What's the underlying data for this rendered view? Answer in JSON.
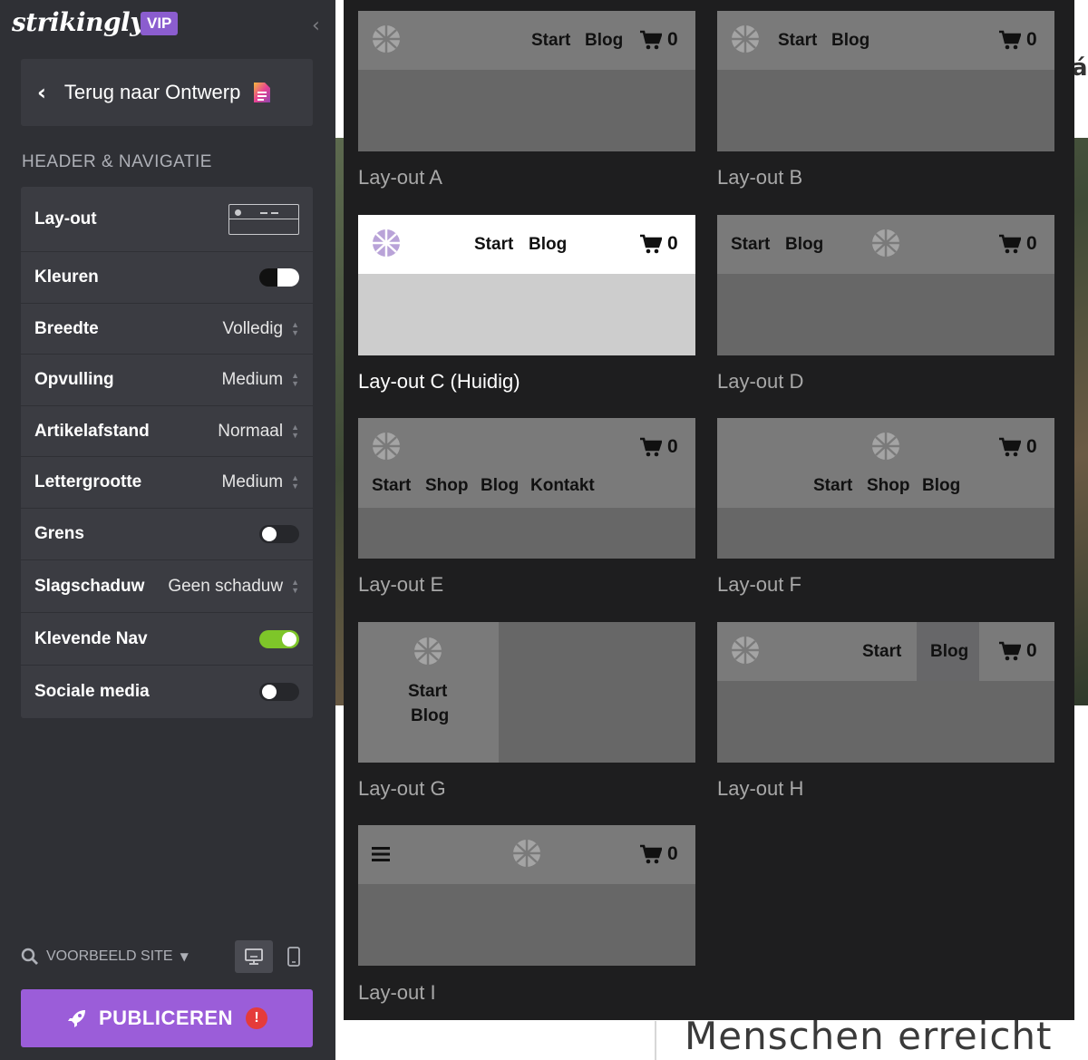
{
  "sidebar": {
    "brand": "strikingly",
    "badge": "VIP",
    "back_label": "Terug naar Ontwerp",
    "section_title": "HEADER & NAVIGATIE",
    "options": [
      {
        "name": "Lay-out",
        "kind": "thumb"
      },
      {
        "name": "Kleuren",
        "kind": "color-toggle"
      },
      {
        "name": "Breedte",
        "kind": "select",
        "value": "Volledig"
      },
      {
        "name": "Opvulling",
        "kind": "select",
        "value": "Medium"
      },
      {
        "name": "Artikelafstand",
        "kind": "select",
        "value": "Normaal"
      },
      {
        "name": "Lettergrootte",
        "kind": "select",
        "value": "Medium"
      },
      {
        "name": "Grens",
        "kind": "toggle",
        "on": false
      },
      {
        "name": "Slagschaduw",
        "kind": "select",
        "value": "Geen schaduw"
      },
      {
        "name": "Klevende Nav",
        "kind": "toggle",
        "on": true
      },
      {
        "name": "Sociale media",
        "kind": "toggle",
        "on": false
      }
    ],
    "preview_label": "VOORBEELD SITE",
    "publish_label": "PUBLICEREN",
    "publish_alert": "!"
  },
  "layouts": {
    "nav": {
      "start": "Start",
      "blog": "Blog",
      "shop": "Shop",
      "kontakt": "Kontakt"
    },
    "cart_count": "0",
    "labels": {
      "a": "Lay-out A",
      "b": "Lay-out B",
      "c": "Lay-out C (Huidig)",
      "d": "Lay-out D",
      "e": "Lay-out E",
      "f": "Lay-out F",
      "g": "Lay-out G",
      "h": "Lay-out H",
      "i": "Lay-out I"
    },
    "current": "c"
  },
  "background": {
    "edge_text": "ág",
    "big_text": "Menschen erreicht"
  },
  "colors": {
    "sidebar_bg": "#2f3035",
    "panel_bg": "#1e1e1f",
    "accent_purple": "#9b5dd9",
    "toggle_on": "#7ec629",
    "alert_red": "#e53b3b"
  }
}
